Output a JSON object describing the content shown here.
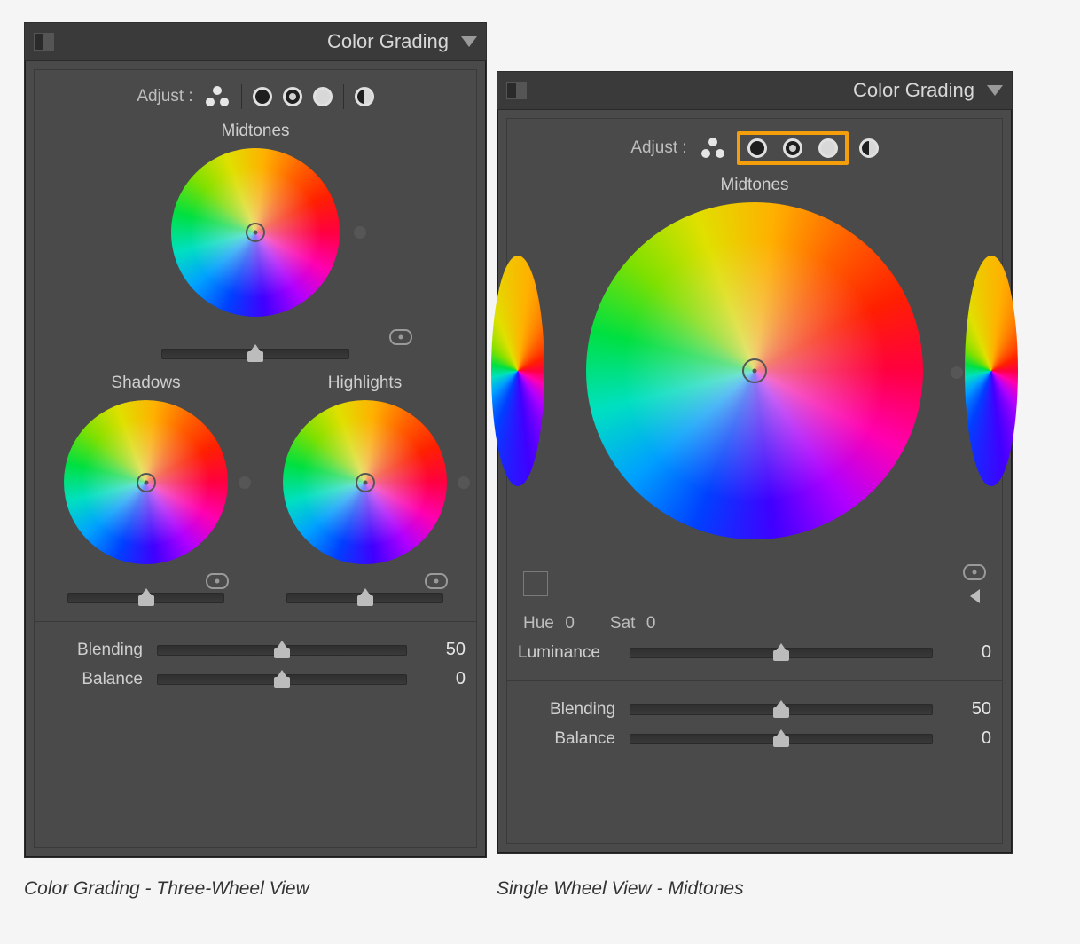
{
  "left": {
    "title": "Color Grading",
    "adjust_label": "Adjust :",
    "midtones": "Midtones",
    "shadows": "Shadows",
    "highlights": "Highlights",
    "blending_label": "Blending",
    "blending_value": "50",
    "balance_label": "Balance",
    "balance_value": "0",
    "caption": "Color Grading - Three-Wheel View"
  },
  "right": {
    "title": "Color Grading",
    "adjust_label": "Adjust :",
    "midtones": "Midtones",
    "hue_label": "Hue",
    "hue_value": "0",
    "sat_label": "Sat",
    "sat_value": "0",
    "luminance_label": "Luminance",
    "luminance_value": "0",
    "blending_label": "Blending",
    "blending_value": "50",
    "balance_label": "Balance",
    "balance_value": "0",
    "caption": "Single Wheel View - Midtones"
  },
  "colors": {
    "highlight": "#f59e0b"
  }
}
